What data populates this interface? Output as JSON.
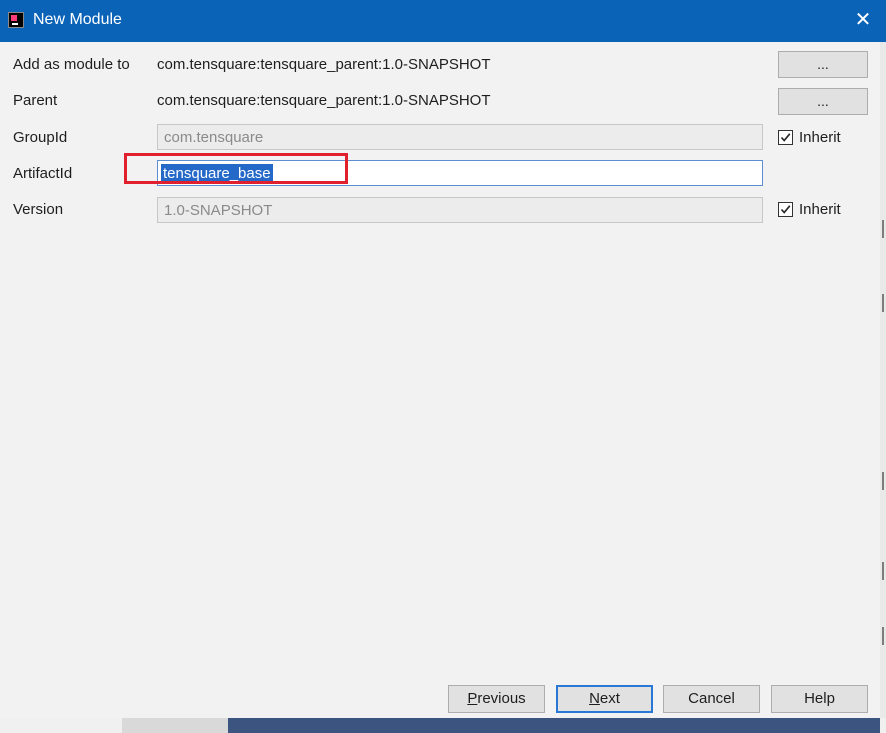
{
  "window": {
    "title": "New Module",
    "icon": "intellij-app-icon",
    "close_icon": "close-icon"
  },
  "form": {
    "add_as_module_to": {
      "label": "Add as module to",
      "value": "com.tensquare:tensquare_parent:1.0-SNAPSHOT",
      "button": "..."
    },
    "parent": {
      "label": "Parent",
      "value": "com.tensquare:tensquare_parent:1.0-SNAPSHOT",
      "button": "..."
    },
    "group_id": {
      "label": "GroupId",
      "value": "com.tensquare",
      "inherit_label": "Inherit",
      "inherit_checked": true
    },
    "artifact_id": {
      "label": "ArtifactId",
      "value": "tensquare_base"
    },
    "version": {
      "label": "Version",
      "value": "1.0-SNAPSHOT",
      "inherit_label": "Inherit",
      "inherit_checked": true
    }
  },
  "footer": {
    "previous": {
      "mnemonic": "P",
      "rest": "revious"
    },
    "next": {
      "mnemonic": "N",
      "rest": "ext"
    },
    "cancel": "Cancel",
    "help": "Help"
  },
  "colors": {
    "titlebar": "#0b63b8",
    "dialog_bg": "#f2f2f2",
    "highlight_box": "#e0202c",
    "selection": "#2468c8"
  }
}
